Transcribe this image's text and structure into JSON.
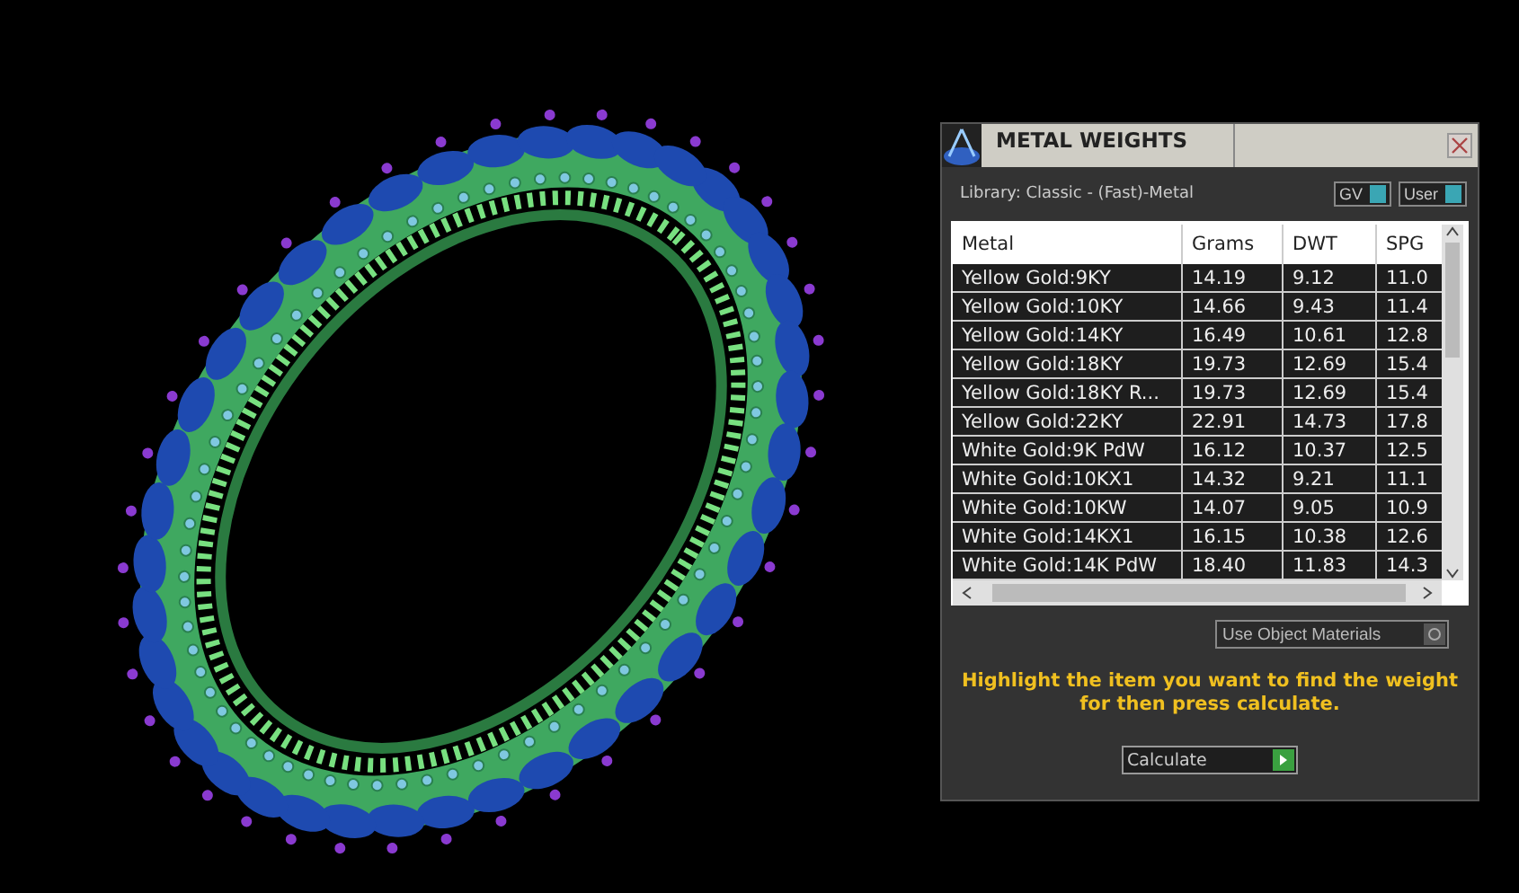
{
  "panel": {
    "title": "METAL WEIGHTS",
    "library_label": "Library: Classic - (Fast)-Metal",
    "toggles": [
      {
        "label": "GV",
        "on": true
      },
      {
        "label": "User",
        "on": true
      }
    ],
    "table": {
      "columns": [
        "Metal",
        "Grams",
        "DWT",
        "SPG"
      ],
      "rows": [
        [
          "Yellow Gold:9KY",
          "14.19",
          "9.12",
          "11.0"
        ],
        [
          "Yellow Gold:10KY",
          "14.66",
          "9.43",
          "11.4"
        ],
        [
          "Yellow Gold:14KY",
          "16.49",
          "10.61",
          "12.8"
        ],
        [
          "Yellow Gold:18KY",
          "19.73",
          "12.69",
          "15.4"
        ],
        [
          "Yellow Gold:18KY R...",
          "19.73",
          "12.69",
          "15.4"
        ],
        [
          "Yellow Gold:22KY",
          "22.91",
          "14.73",
          "17.8"
        ],
        [
          "White Gold:9K PdW",
          "16.12",
          "10.37",
          "12.5"
        ],
        [
          "White Gold:10KX1",
          "14.32",
          "9.21",
          "11.1"
        ],
        [
          "White Gold:10KW",
          "14.07",
          "9.05",
          "10.9"
        ],
        [
          "White Gold:14KX1",
          "16.15",
          "10.38",
          "12.6"
        ],
        [
          "White Gold:14K PdW",
          "18.40",
          "11.83",
          "14.3"
        ]
      ]
    },
    "use_object_materials": {
      "label": "Use Object Materials",
      "on": false
    },
    "instruction": "Highlight the item you want to find the weight for then press calculate.",
    "calculate_button": "Calculate"
  }
}
